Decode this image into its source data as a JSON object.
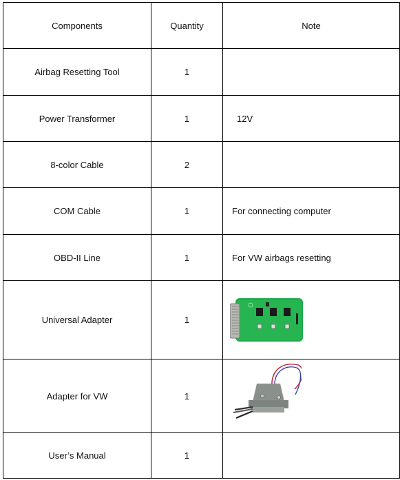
{
  "table": {
    "headers": {
      "components": "Components",
      "quantity": "Quantity",
      "note": "Note"
    },
    "rows": [
      {
        "component": "Airbag Resetting Tool",
        "quantity": "1",
        "note": ""
      },
      {
        "component": "Power Transformer",
        "quantity": "1",
        "note": "12V"
      },
      {
        "component": "8-color Cable",
        "quantity": "2",
        "note": ""
      },
      {
        "component": "COM Cable",
        "quantity": "1",
        "note": "For connecting computer"
      },
      {
        "component": "OBD-II Line",
        "quantity": "1",
        "note": "For VW airbags resetting"
      },
      {
        "component": "Universal Adapter",
        "quantity": "1",
        "note": "",
        "image": "universal-adapter-pcb-photo"
      },
      {
        "component": "Adapter for VW",
        "quantity": "1",
        "note": "",
        "image": "vw-adapter-db-connector-photo"
      },
      {
        "component": "User’s Manual",
        "quantity": "1",
        "note": ""
      }
    ]
  }
}
